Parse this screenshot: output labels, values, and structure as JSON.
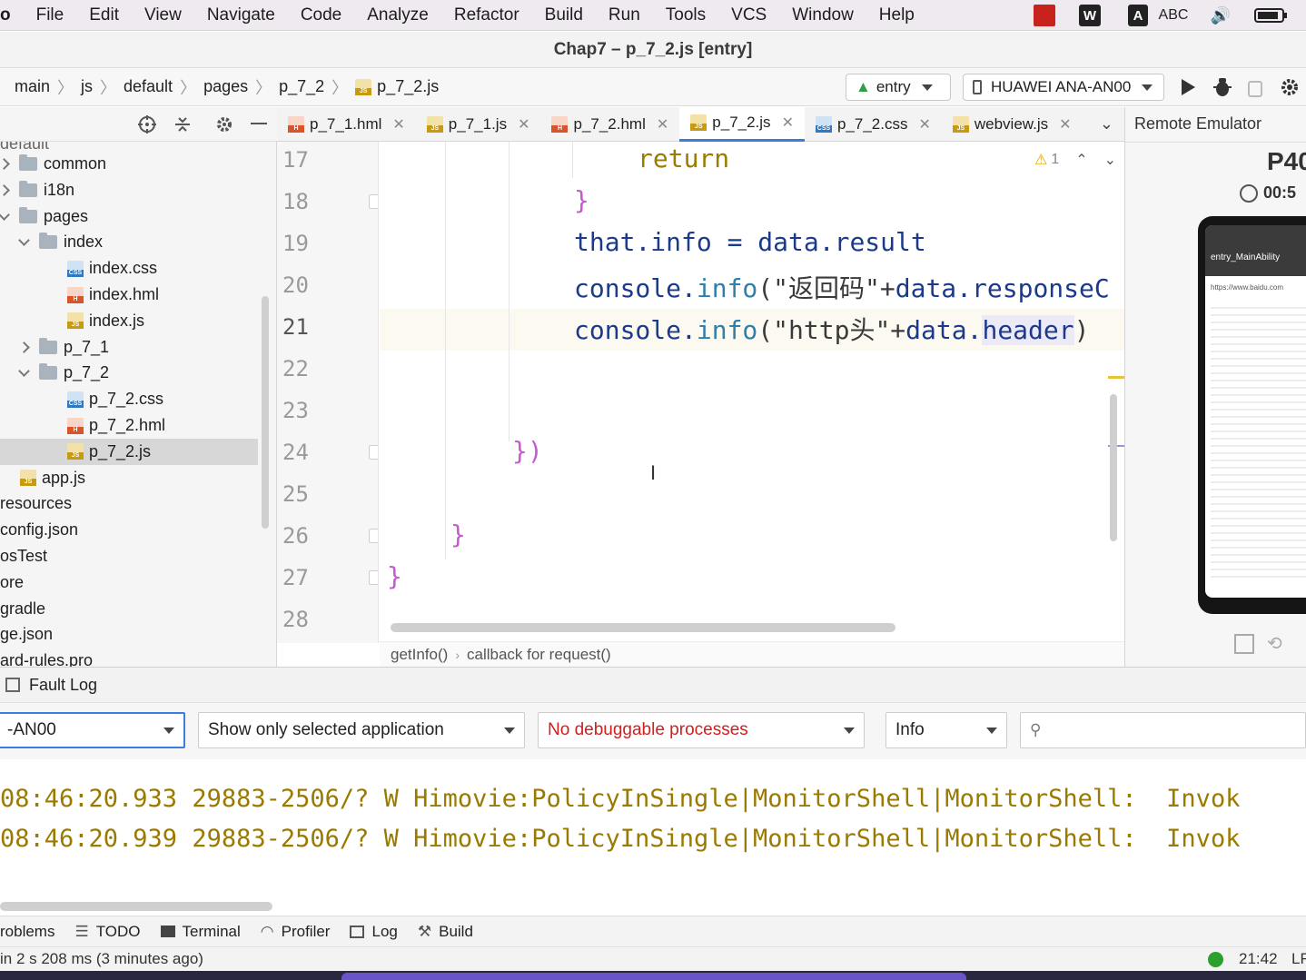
{
  "menubar": {
    "app_fragment": "o",
    "items": [
      "File",
      "Edit",
      "View",
      "Navigate",
      "Code",
      "Analyze",
      "Refactor",
      "Build",
      "Run",
      "Tools",
      "VCS",
      "Window",
      "Help"
    ],
    "input_badge": "A",
    "input_method": "ABC"
  },
  "title": "Chap7 – p_7_2.js [entry]",
  "breadcrumb": [
    "main",
    "js",
    "default",
    "pages",
    "p_7_2",
    "p_7_2.js"
  ],
  "run_config": {
    "module": "entry",
    "device": "HUAWEI ANA-AN00"
  },
  "project_tree": {
    "top_cut": "default",
    "rows": [
      {
        "label": "common",
        "kind": "folder",
        "arrow": "right"
      },
      {
        "label": "i18n",
        "kind": "folder",
        "arrow": "right"
      },
      {
        "label": "pages",
        "kind": "folder",
        "arrow": "down"
      },
      {
        "label": "index",
        "kind": "folder",
        "arrow": "down"
      },
      {
        "label": "index.css",
        "kind": "css"
      },
      {
        "label": "index.hml",
        "kind": "hml"
      },
      {
        "label": "index.js",
        "kind": "js"
      },
      {
        "label": "p_7_1",
        "kind": "folder",
        "arrow": "right"
      },
      {
        "label": "p_7_2",
        "kind": "folder",
        "arrow": "down"
      },
      {
        "label": "p_7_2.css",
        "kind": "css"
      },
      {
        "label": "p_7_2.hml",
        "kind": "hml"
      },
      {
        "label": "p_7_2.js",
        "kind": "js",
        "selected": true
      },
      {
        "label": "app.js",
        "kind": "js"
      },
      {
        "label": "resources",
        "kind": "text"
      },
      {
        "label": "config.json",
        "kind": "text"
      },
      {
        "label": "osTest",
        "kind": "text"
      },
      {
        "label": "ore",
        "kind": "text"
      },
      {
        "label": "gradle",
        "kind": "text"
      },
      {
        "label": "ge.json",
        "kind": "text"
      },
      {
        "label": "ard-rules.pro",
        "kind": "text"
      }
    ]
  },
  "tabs": [
    {
      "label": "p_7_1.hml",
      "kind": "hml"
    },
    {
      "label": "p_7_1.js",
      "kind": "js"
    },
    {
      "label": "p_7_2.hml",
      "kind": "hml"
    },
    {
      "label": "p_7_2.js",
      "kind": "js",
      "active": true
    },
    {
      "label": "p_7_2.css",
      "kind": "css"
    },
    {
      "label": "webview.js",
      "kind": "js"
    }
  ],
  "editor": {
    "line_numbers": [
      "17",
      "18",
      "19",
      "20",
      "21",
      "22",
      "23",
      "24",
      "25",
      "26",
      "27",
      "28"
    ],
    "warning_count": "1",
    "code": {
      "l17": "return",
      "l18": "}",
      "l19_a": "that",
      "l19_b": ".info = ",
      "l19_c": "data",
      "l19_d": ".result",
      "l20_a": "console.",
      "l20_b": "info",
      "l20_c": "(\"返回码\"+",
      "l20_d": "data.responseC",
      "l21_a": "console.",
      "l21_b": "info",
      "l21_c": "(\"http头\"+",
      "l21_d": "data.",
      "l21_e": "header",
      "l21_f": ")",
      "l24": "})",
      "l26": "}",
      "l27": "}"
    },
    "nav_breadcrumb": [
      "getInfo()",
      "callback for request()"
    ]
  },
  "remote_emulator": {
    "title": "Remote Emulator",
    "device_cut": "P40",
    "timer_cut": "00:5",
    "screen_title": "entry_MainAbility",
    "screen_url": "https://www.baidu.com"
  },
  "fault_log": {
    "label": "Fault Log"
  },
  "logcat": {
    "device_sel": "-AN00",
    "filter_sel": "Show only selected application",
    "process_sel": "No debuggable processes",
    "level_sel": "Info",
    "search_placeholder": "",
    "lines": [
      "08:46:20.933 29883-2506/? W Himovie:PolicyInSingle|MonitorShell|MonitorShell:  Invok",
      "08:46:20.939 29883-2506/? W Himovie:PolicyInSingle|MonitorShell|MonitorShell:  Invok"
    ]
  },
  "tool_windows": [
    "roblems",
    "TODO",
    "Terminal",
    "Profiler",
    "Log",
    "Build"
  ],
  "status": {
    "message": "in 2 s 208 ms (3 minutes ago)",
    "time": "21:42",
    "line_sep": "LF"
  },
  "colors": {
    "accent": "#3b7ddd",
    "keyword": "#9a7d00",
    "bracket": "#c45ad0",
    "log_warn": "#9a7a00",
    "error_text": "#d02020",
    "status_ok": "#2ca02c"
  }
}
